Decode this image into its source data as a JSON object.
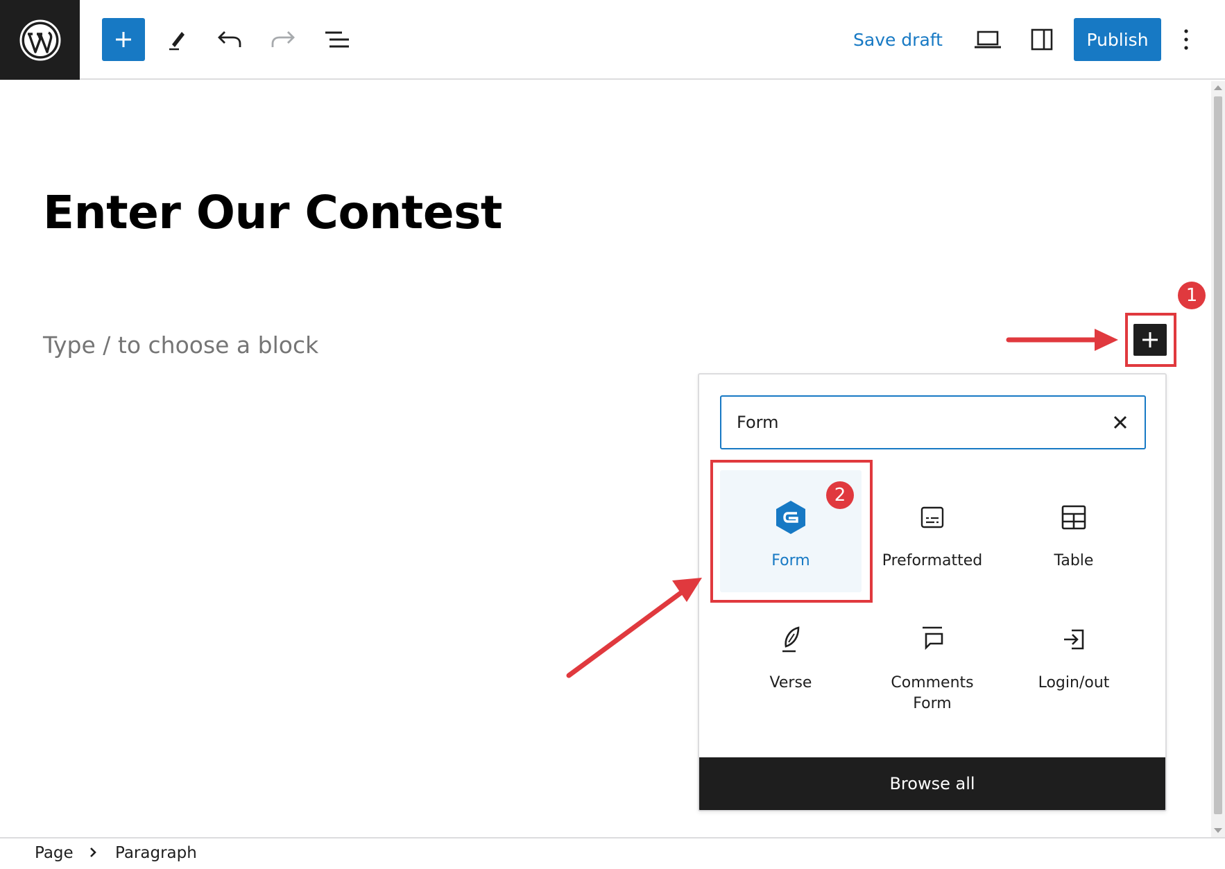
{
  "colors": {
    "accent": "#1779c4",
    "annotation": "#e0393e",
    "dark": "#1e1e1e"
  },
  "toolbar": {
    "logo_icon": "wordpress-logo-icon",
    "add_block_icon": "plus-icon",
    "tools_icon": "pencil-icon",
    "undo_icon": "undo-icon",
    "redo_icon": "redo-icon",
    "list_view_icon": "list-view-icon",
    "save_draft_label": "Save draft",
    "preview_icon": "laptop-icon",
    "settings_icon": "sidebar-icon",
    "publish_label": "Publish",
    "options_icon": "more-vertical-icon"
  },
  "editor": {
    "title": "Enter Our Contest",
    "block_placeholder": "Type / to choose a block"
  },
  "annotations": {
    "step1": "1",
    "step2": "2"
  },
  "inserter": {
    "search_value": "Form",
    "blocks": [
      {
        "label": "Form",
        "icon": "gravity-forms-icon",
        "selected": true
      },
      {
        "label": "Preformatted",
        "icon": "preformatted-icon",
        "selected": false
      },
      {
        "label": "Table",
        "icon": "table-icon",
        "selected": false
      },
      {
        "label": "Verse",
        "icon": "feather-icon",
        "selected": false
      },
      {
        "label": "Comments Form",
        "icon": "comments-form-icon",
        "selected": false
      },
      {
        "label": "Login/out",
        "icon": "login-icon",
        "selected": false
      }
    ],
    "browse_all_label": "Browse all"
  },
  "breadcrumb": {
    "items": [
      "Page",
      "Paragraph"
    ]
  }
}
